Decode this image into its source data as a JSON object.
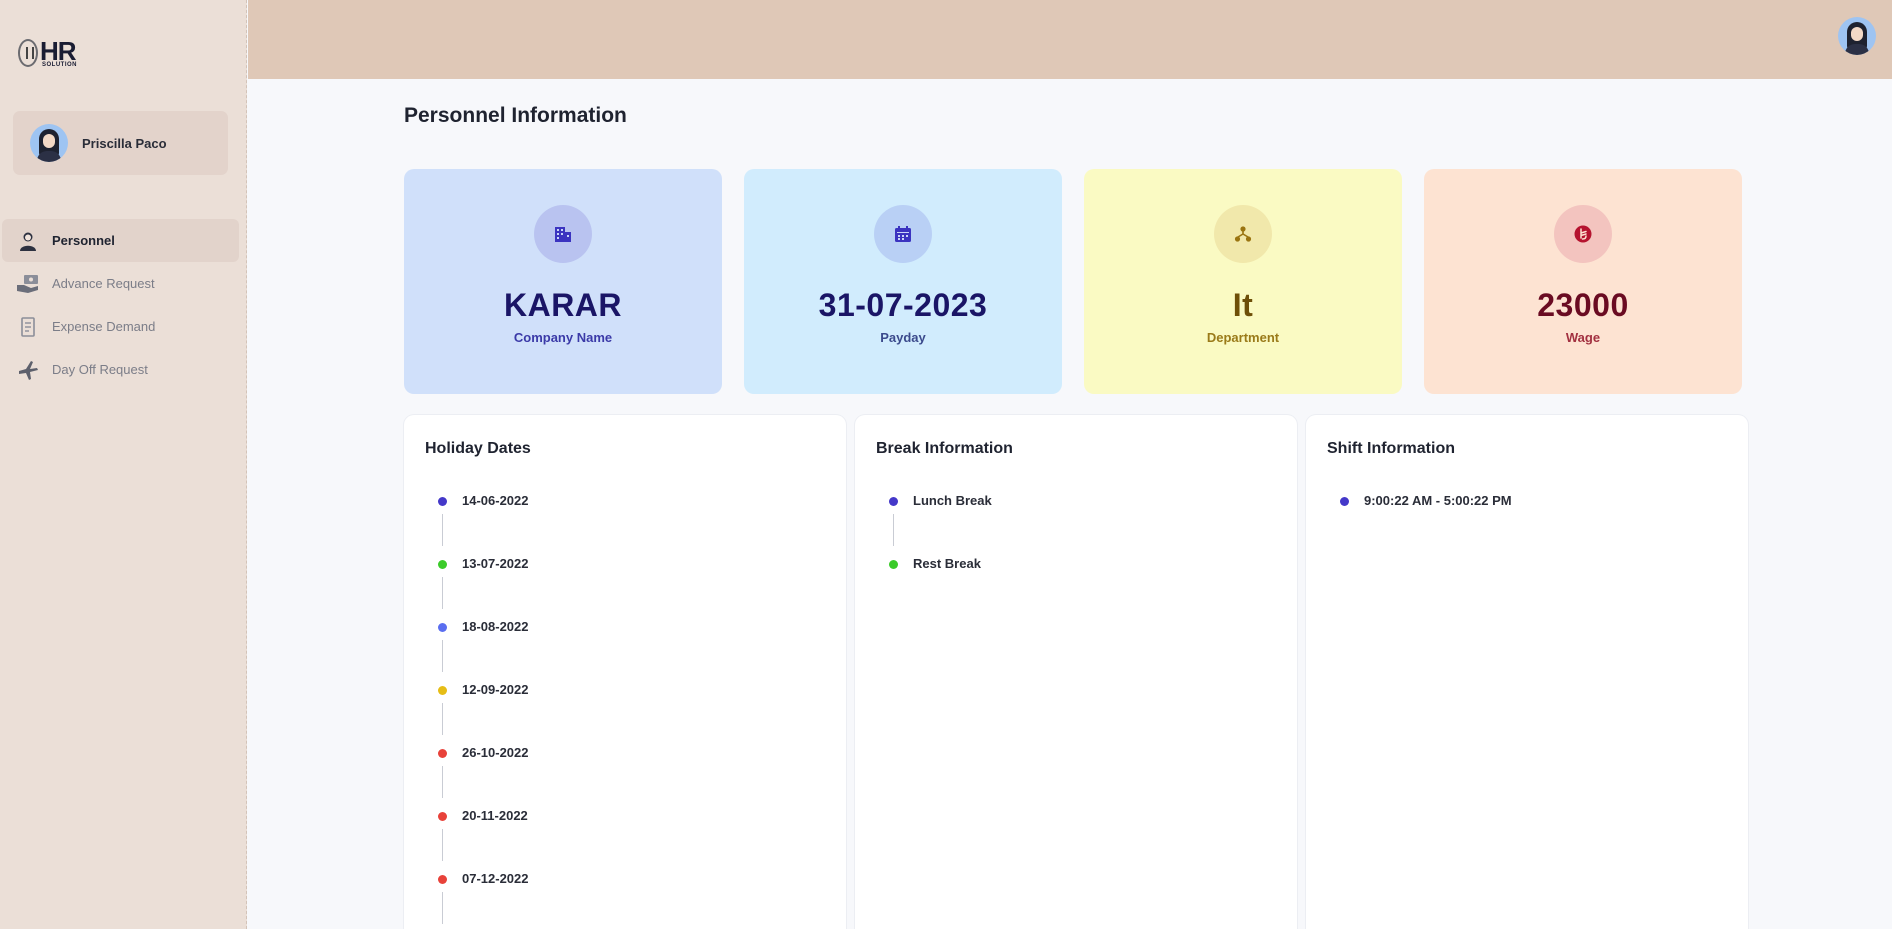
{
  "logo": {
    "main": "HR",
    "sub": "SOLUTION"
  },
  "user": {
    "name": "Priscilla Paco"
  },
  "nav": [
    {
      "label": "Personnel",
      "icon": "person-icon"
    },
    {
      "label": "Advance Request",
      "icon": "money-hand-icon"
    },
    {
      "label": "Expense Demand",
      "icon": "receipt-icon"
    },
    {
      "label": "Day Off Request",
      "icon": "airplane-icon"
    }
  ],
  "page": {
    "title": "Personnel Information"
  },
  "stats": [
    {
      "value": "KARAR",
      "label": "Company Name",
      "icon": "building-icon",
      "bg": "#d0e0fa",
      "icon_bg": "#b3bbef",
      "value_color": "#1a1566",
      "label_color": "#3b3aa8"
    },
    {
      "value": "31-07-2023",
      "label": "Payday",
      "icon": "calendar-icon",
      "bg": "#d1ecfd",
      "icon_bg": "#b7cdf5",
      "value_color": "#1a1566",
      "label_color": "#3b4a8c"
    },
    {
      "value": "It",
      "label": "Department",
      "icon": "org-chart-icon",
      "bg": "#fafac3",
      "icon_bg": "#f0e7a9",
      "value_color": "#6e4f08",
      "label_color": "#9a7a19"
    },
    {
      "value": "23000",
      "label": "Wage",
      "icon": "currency-icon",
      "bg": "#fde3d2",
      "icon_bg": "#f4c1bd",
      "value_color": "#6a0b22",
      "label_color": "#a23040"
    }
  ],
  "panels": {
    "holidays": {
      "title": "Holiday Dates",
      "items": [
        {
          "text": "14-06-2022",
          "color": "#4438c9"
        },
        {
          "text": "13-07-2022",
          "color": "#3bcb2a"
        },
        {
          "text": "18-08-2022",
          "color": "#5a6ef0"
        },
        {
          "text": "12-09-2022",
          "color": "#e6bd16"
        },
        {
          "text": "26-10-2022",
          "color": "#e8423a"
        },
        {
          "text": "20-11-2022",
          "color": "#e8423a"
        },
        {
          "text": "07-12-2022",
          "color": "#e8423a"
        }
      ]
    },
    "breaks": {
      "title": "Break Information",
      "items": [
        {
          "text": "Lunch Break",
          "color": "#4438c9"
        },
        {
          "text": "Rest Break",
          "color": "#3bcb2a"
        }
      ]
    },
    "shifts": {
      "title": "Shift Information",
      "items": [
        {
          "text": "9:00:22 AM - 5:00:22 PM",
          "color": "#4438c9"
        }
      ]
    }
  }
}
